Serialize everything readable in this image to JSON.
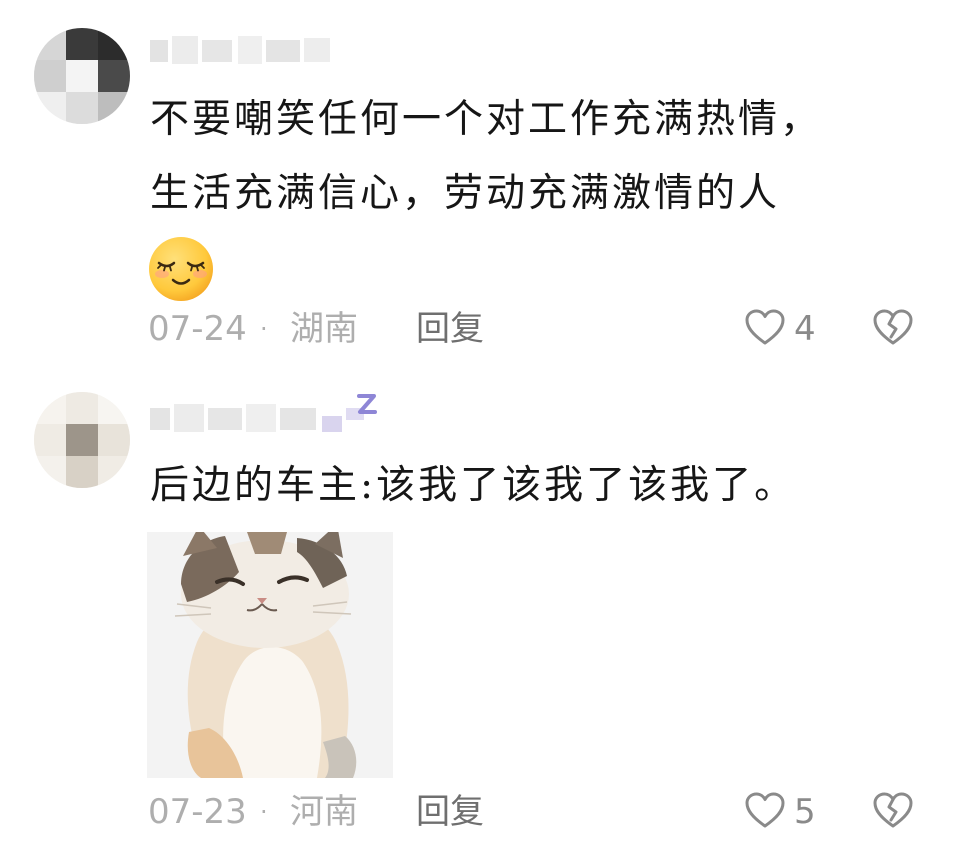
{
  "comments": [
    {
      "text_lines": [
        "不要嘲笑任何一个对工作充满热情，",
        "生活充满信心，劳动充满激情的人"
      ],
      "emoji": "smile-closed-eyes-emoji",
      "date": "07-24",
      "separator": "·",
      "location": "湖南",
      "reply_label": "回复",
      "like_count": "4"
    },
    {
      "text_lines": [
        "后边的车主:该我了该我了该我了。"
      ],
      "image": "cat-sticker",
      "date": "07-23",
      "separator": "·",
      "location": "河南",
      "reply_label": "回复",
      "like_count": "5"
    }
  ],
  "icons": {
    "like": "heart-outline-icon",
    "dislike": "broken-heart-icon"
  },
  "colors": {
    "meta_text": "#aeaeae",
    "reply_text": "#6f6f6f",
    "icon_stroke": "#8a8a8a",
    "emoji_yellow": "#ffc93c"
  }
}
